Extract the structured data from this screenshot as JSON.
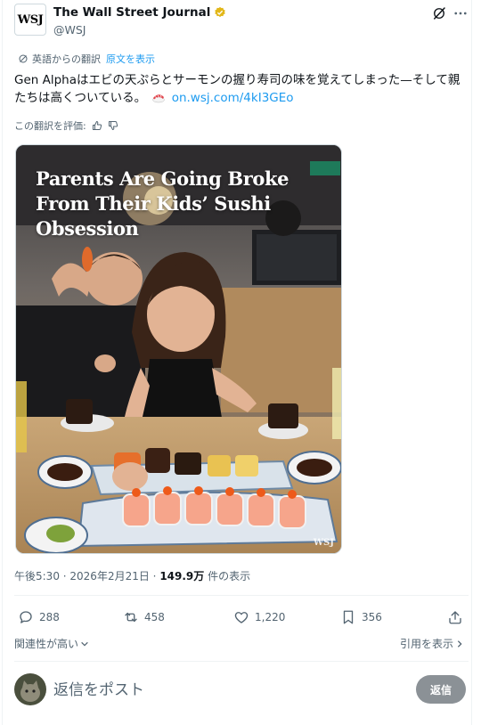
{
  "author": {
    "avatar_text": "WSJ",
    "display_name": "The Wall Street Journal",
    "handle": "@WSJ"
  },
  "translation": {
    "label": "英語からの翻訳",
    "show_original": "原文を表示",
    "rate_label": "この翻訳を評価:"
  },
  "tweet": {
    "text_part1": "Gen Alphaはエビの天ぷらとサーモンの握り寿司の味を覚えてしまった—そして親たちは高くついている。",
    "link": "on.wsj.com/4kI3GEo"
  },
  "media": {
    "headline": "Parents Are Going Broke From Their Kids’ Sushi Obsession",
    "watermark": "WSJ"
  },
  "meta": {
    "time": "午後5:30",
    "separator": " · ",
    "date": "2026年2月21日",
    "views_count": "149.9万",
    "views_label": " 件の表示"
  },
  "actions": {
    "replies": "288",
    "reposts": "458",
    "likes": "1,220",
    "bookmarks": "356"
  },
  "sort": {
    "relevance_label": "関連性が高い",
    "quotes_label": "引用を表示"
  },
  "reply": {
    "placeholder": "返信をポスト",
    "button_label": "返信"
  },
  "colors": {
    "link": "#1d9bf0",
    "muted": "#536471",
    "verified": "#e2b719",
    "reply_button": "#8b9196"
  }
}
